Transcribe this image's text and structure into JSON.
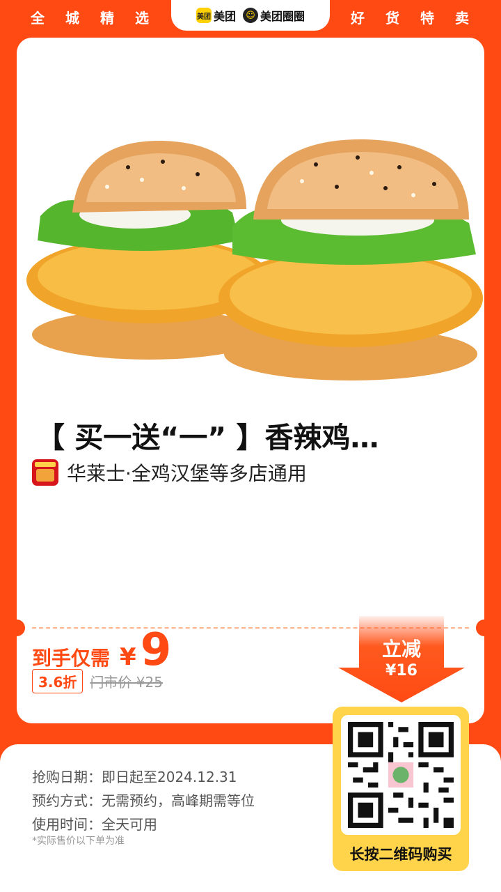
{
  "header": {
    "left_chars": [
      "全",
      "城",
      "精",
      "选"
    ],
    "right_chars": [
      "好",
      "货",
      "特",
      "卖"
    ],
    "logo_badge": "美团",
    "logo_text_1": "美团",
    "logo_text_2": "美团圈圈"
  },
  "product": {
    "title": "【 买一送“一” 】香辣鸡…",
    "brand": "华莱士·全鸡汉堡等多店通用"
  },
  "price": {
    "label": "到手仅需",
    "currency": "¥",
    "value": "9",
    "discount": "3.6折",
    "original": "门市价 ¥25"
  },
  "promo": {
    "label": "立减",
    "amount": "¥16"
  },
  "info": {
    "rows": [
      {
        "key": "抢购日期：",
        "value": "即日起至2024.12.31"
      },
      {
        "key": "预约方式：",
        "value": "无需预约，高峰期需等位"
      },
      {
        "key": "使用时间：",
        "value": "全天可用"
      }
    ],
    "note": "*实际售价以下单为准"
  },
  "qr": {
    "caption": "长按二维码购买"
  },
  "colors": {
    "accent": "#ff4a14",
    "qr_frame": "#ffd34a"
  }
}
